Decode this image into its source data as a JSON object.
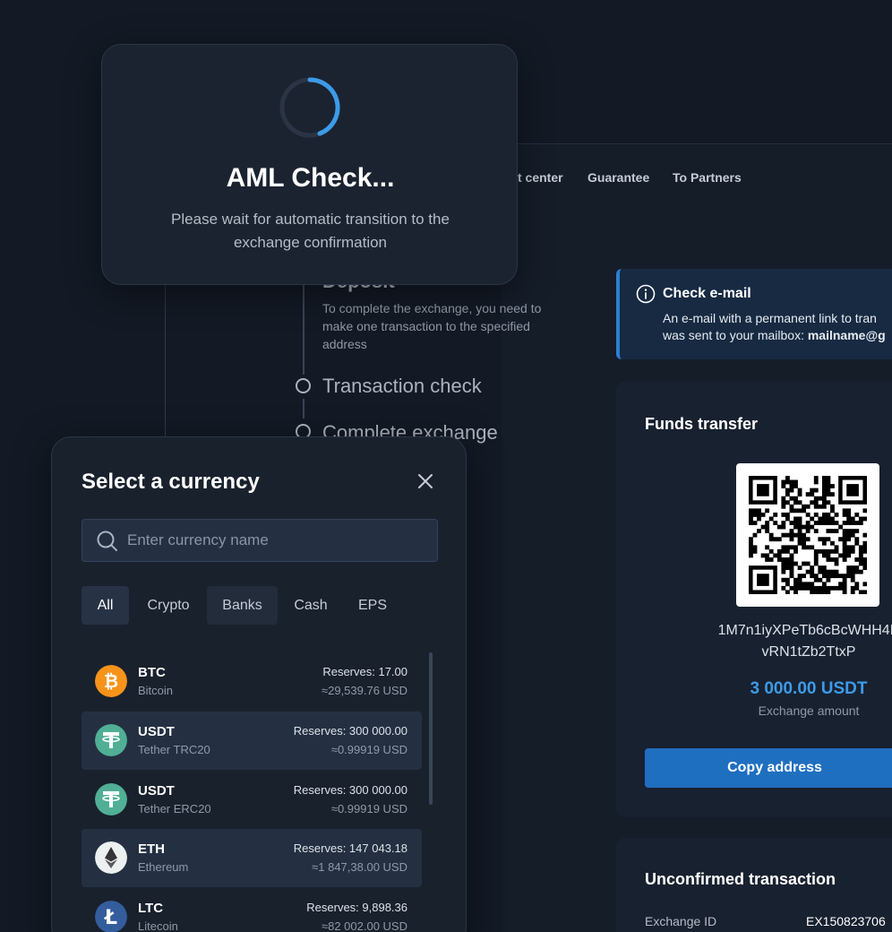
{
  "nav": {
    "items": [
      "t center",
      "Guarantee",
      "To Partners"
    ]
  },
  "steps": {
    "deposit_title": "Deposit",
    "deposit_desc": "To complete the exchange, you need to make one transaction to the specified address",
    "transaction_check": "Transaction check",
    "complete_exchange": "Complete exchange"
  },
  "aml": {
    "title": "AML Check...",
    "subtitle": "Please wait for automatic transition to the exchange confirmation"
  },
  "email": {
    "title": "Check e-mail",
    "line1": "An e-mail with a permanent link to tran",
    "line2_prefix": "was sent to your mailbox: ",
    "line2_mail": "mailname@g"
  },
  "funds": {
    "title": "Funds transfer",
    "address_line1": "1M7n1iyXPeTb6cBcWHH4K",
    "address_line2": "vRN1tZb2TtxP",
    "amount": "3 000.00 USDT",
    "amount_label": "Exchange amount",
    "copy_button": "Copy address"
  },
  "unconfirmed": {
    "title": "Unconfirmed transaction",
    "exchange_id_label": "Exchange ID",
    "exchange_id_value": "EX150823706"
  },
  "currency_modal": {
    "title": "Select a currency",
    "search_placeholder": "Enter currency name",
    "tabs": [
      "All",
      "Crypto",
      "Banks",
      "Cash",
      "EPS"
    ],
    "active_tab": "All",
    "items": [
      {
        "code": "BTC",
        "name": "Bitcoin",
        "reserves": "Reserves: 17.00",
        "usd": "≈29,539.76 USD",
        "icon": "bitcoin-icon",
        "color": "#f7931a"
      },
      {
        "code": "USDT",
        "name": "Tether TRC20",
        "reserves": "Reserves: 300 000.00",
        "usd": "≈0.99919 USD",
        "icon": "tether-icon",
        "color": "#50af95",
        "selected": true
      },
      {
        "code": "USDT",
        "name": "Tether ERC20",
        "reserves": "Reserves: 300 000.00",
        "usd": "≈0.99919 USD",
        "icon": "tether-icon",
        "color": "#50af95"
      },
      {
        "code": "ETH",
        "name": "Ethereum",
        "reserves": "Reserves: 147 043.18",
        "usd": "≈1 847,38.00 USD",
        "icon": "ethereum-icon",
        "color": "#ecf0f1",
        "selected": true
      },
      {
        "code": "LTC",
        "name": "Litecoin",
        "reserves": "Reserves: 9,898.36",
        "usd": "≈82 002.00 USD",
        "icon": "litecoin-icon",
        "color": "#345d9d"
      }
    ]
  },
  "colors": {
    "accent": "#1f6fc0",
    "amount": "#3d9be9",
    "background": "#131a25"
  }
}
